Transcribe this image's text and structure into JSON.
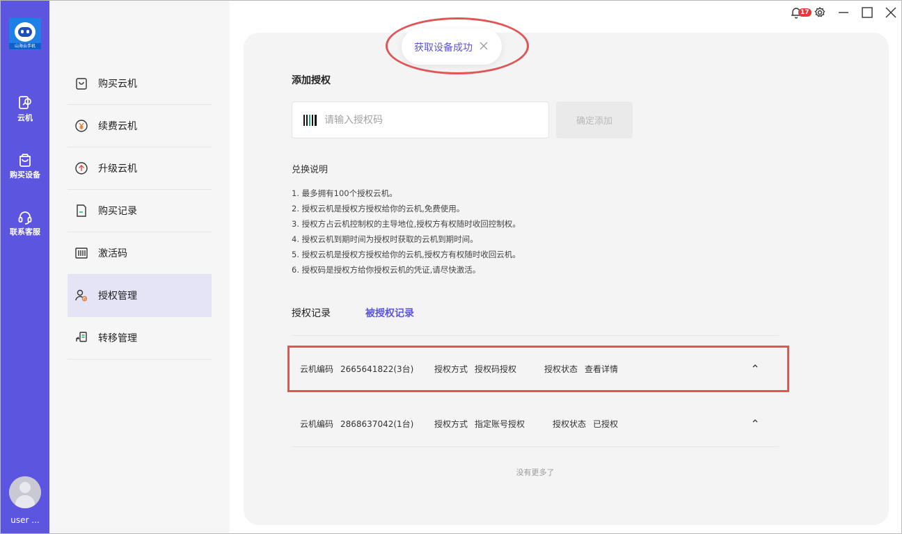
{
  "app": {
    "brand": "山海云手机",
    "username": "user ...",
    "notification_count": "17"
  },
  "rail": {
    "items": [
      {
        "label": "云机",
        "icon": "cloud-phone-icon"
      },
      {
        "label": "购买设备",
        "icon": "shopping-bag-icon"
      },
      {
        "label": "联系客服",
        "icon": "headset-icon"
      }
    ]
  },
  "sidebar": {
    "items": [
      {
        "label": "购买云机",
        "icon": "shopping-bag-icon"
      },
      {
        "label": "续费云机",
        "icon": "yen-coin-icon"
      },
      {
        "label": "升级云机",
        "icon": "upgrade-arrow-icon"
      },
      {
        "label": "购买记录",
        "icon": "document-icon"
      },
      {
        "label": "激活码",
        "icon": "barcode-icon"
      },
      {
        "label": "授权管理",
        "icon": "user-authorize-icon",
        "active": true
      },
      {
        "label": "转移管理",
        "icon": "transfer-icon"
      }
    ]
  },
  "toast": {
    "message": "获取设备成功"
  },
  "auth": {
    "title": "添加授权",
    "input_placeholder": "请输入授权码",
    "confirm_label": "确定添加"
  },
  "notes": {
    "title": "兑换说明",
    "lines": [
      "1. 最多拥有100个授权云机。",
      "2. 授权云机是授权方授权给你的云机,免费使用。",
      "3. 授权方占云机控制权的主导地位,授权方有权随时收回控制权。",
      "4. 授权云机到期时间为授权时获取的云机到期时间。",
      "5. 授权云机是授权方授权给你的云机,授权方有权随时收回云机。",
      "6. 授权码是授权方给你授权云机的凭证,请尽快激活。"
    ]
  },
  "tabs": [
    {
      "label": "授权记录",
      "active": false
    },
    {
      "label": "被授权记录",
      "active": true
    }
  ],
  "records": [
    {
      "code_label": "云机编码",
      "code": "2665641822(3台)",
      "method_label": "授权方式",
      "method": "授权码授权",
      "status_label": "授权状态",
      "status": "查看详情"
    },
    {
      "code_label": "云机编码",
      "code": "2868637042(1台)",
      "method_label": "授权方式",
      "method": "指定账号授权",
      "status_label": "授权状态",
      "status": "已授权"
    }
  ],
  "footer": {
    "no_more": "没有更多了"
  },
  "colors": {
    "accent": "#5b55e0",
    "highlight": "#e05555"
  }
}
